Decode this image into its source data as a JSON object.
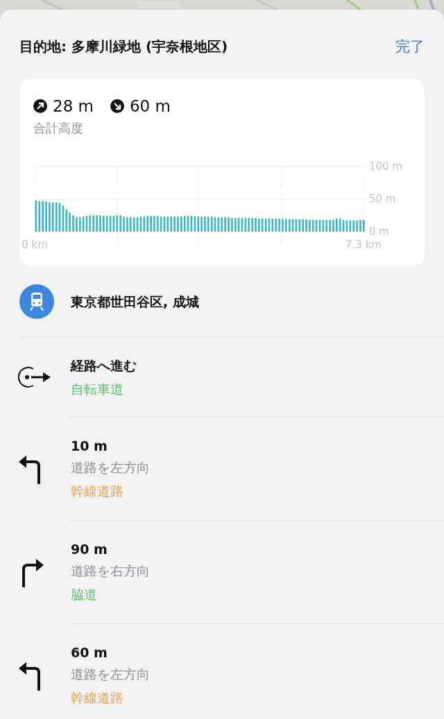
{
  "header": {
    "title": "目的地: 多摩川緑地 (宇奈根地区)",
    "done": "完了"
  },
  "elevation": {
    "ascent": "28 m",
    "descent": "60 m",
    "label": "合計高度",
    "chart_data": {
      "type": "bar",
      "xlim": [
        0,
        7.3
      ],
      "ylim": [
        0,
        100
      ],
      "xticks": [
        {
          "value": 0,
          "label": "0 km"
        },
        {
          "value": 7.3,
          "label": "7.3 km"
        }
      ],
      "yticks": [
        {
          "value": 0,
          "label": "0 m"
        },
        {
          "value": 50,
          "label": "50 m"
        },
        {
          "value": 100,
          "label": "100 m"
        }
      ],
      "x": [
        0,
        0.075,
        0.15,
        0.225,
        0.3,
        0.375,
        0.45,
        0.525,
        0.6,
        0.675,
        0.75,
        0.825,
        0.9,
        0.975,
        1.05,
        1.125,
        1.2,
        1.275,
        1.35,
        1.425,
        1.5,
        1.575,
        1.65,
        1.725,
        1.8,
        1.875,
        1.95,
        2.025,
        2.1,
        2.175,
        2.25,
        2.325,
        2.4,
        2.475,
        2.55,
        2.625,
        2.7,
        2.775,
        2.85,
        2.925,
        3,
        3.075,
        3.15,
        3.225,
        3.3,
        3.375,
        3.45,
        3.525,
        3.6,
        3.675,
        3.75,
        3.825,
        3.9,
        3.975,
        4.05,
        4.125,
        4.2,
        4.275,
        4.35,
        4.425,
        4.5,
        4.575,
        4.65,
        4.725,
        4.8,
        4.875,
        4.95,
        5.025,
        5.1,
        5.175,
        5.25,
        5.325,
        5.4,
        5.475,
        5.55,
        5.625,
        5.7,
        5.775,
        5.85,
        5.925,
        6,
        6.075,
        6.15,
        6.225,
        6.3,
        6.375,
        6.45,
        6.525,
        6.6,
        6.675,
        6.75,
        6.825,
        6.9,
        6.975,
        7.05,
        7.125,
        7.2,
        7.275
      ],
      "values": [
        48,
        47,
        47,
        46,
        45,
        45,
        45,
        44,
        40,
        34,
        29,
        25,
        22,
        22,
        23,
        24,
        25,
        25,
        25,
        25,
        24,
        24,
        24,
        24,
        25,
        25,
        23,
        22,
        22,
        22,
        22,
        23,
        23,
        24,
        24,
        24,
        24,
        23,
        23,
        23,
        23,
        23,
        23,
        23,
        24,
        24,
        24,
        23,
        23,
        23,
        23,
        23,
        23,
        22,
        22,
        22,
        22,
        22,
        21,
        21,
        21,
        21,
        21,
        21,
        21,
        21,
        20,
        20,
        20,
        20,
        20,
        20,
        20,
        19,
        19,
        19,
        19,
        19,
        19,
        19,
        19,
        18,
        18,
        18,
        18,
        18,
        18,
        18,
        18,
        20,
        20,
        18,
        17,
        17,
        17,
        17,
        18,
        18
      ]
    }
  },
  "origin": {
    "text": "東京都世田谷区, 成城"
  },
  "steps": [
    {
      "kind": "start",
      "title": "経路へ進む",
      "road": "自転車道",
      "color": "#5cbf6a"
    },
    {
      "kind": "left",
      "title": "10 m",
      "instruction": "道路を左方向",
      "road": "幹線道路",
      "color": "#e8a04a"
    },
    {
      "kind": "right",
      "title": "90 m",
      "instruction": "道路を右方向",
      "road": "脇道",
      "color": "#5cbf6a"
    },
    {
      "kind": "left",
      "title": "60 m",
      "instruction": "道路を左方向",
      "road": "幹線道路",
      "color": "#e8a04a"
    }
  ]
}
